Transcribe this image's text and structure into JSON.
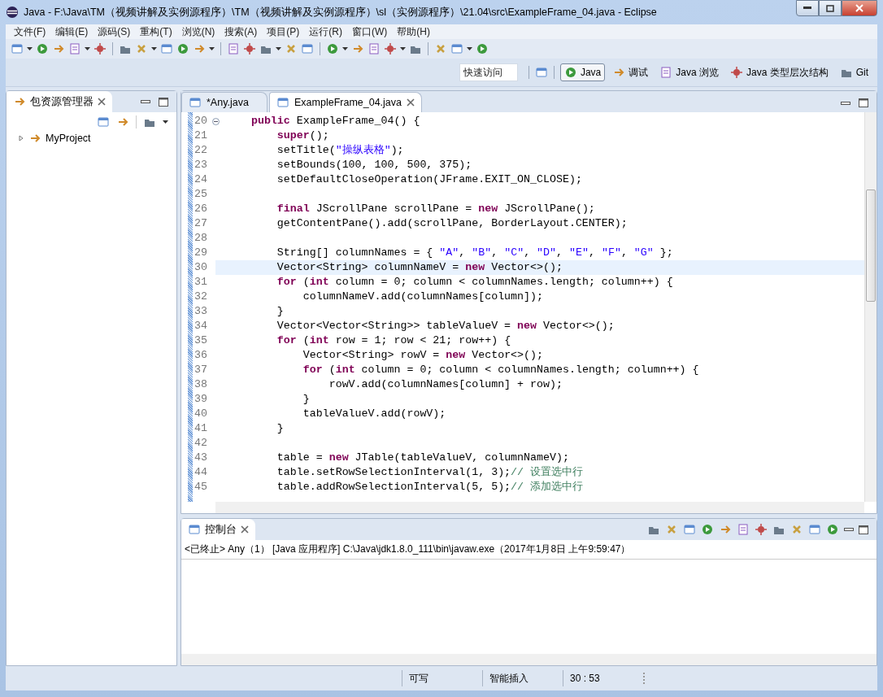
{
  "window": {
    "title": "Java  -  F:\\Java\\TM（视频讲解及实例源程序）\\TM（视频讲解及实例源程序）\\sl（实例源程序）\\21.04\\src\\ExampleFrame_04.java  -  Eclipse"
  },
  "menu": [
    "文件(F)",
    "编辑(E)",
    "源码(S)",
    "重构(T)",
    "浏览(N)",
    "搜索(A)",
    "项目(P)",
    "运行(R)",
    "窗口(W)",
    "帮助(H)"
  ],
  "quick_access": {
    "placeholder": "快速访问"
  },
  "perspectives": [
    {
      "label": "Java",
      "selected": true
    },
    {
      "label": "调试",
      "selected": false
    },
    {
      "label": "Java 浏览",
      "selected": false
    },
    {
      "label": "Java 类型层次结构",
      "selected": false
    },
    {
      "label": "Git",
      "selected": false
    }
  ],
  "explorer": {
    "title": "包资源管理器",
    "items": [
      {
        "label": "MyProject",
        "expanded": false
      }
    ]
  },
  "editor": {
    "tabs": [
      {
        "label": "*Any.java",
        "selected": false
      },
      {
        "label": "ExampleFrame_04.java",
        "selected": true
      }
    ],
    "lines": [
      {
        "number": "20",
        "fold": true,
        "current": false,
        "segments": [
          {
            "kind": "keyword",
            "text": "    public"
          },
          {
            "kind": "plain",
            "text": " ExampleFrame_04() {"
          }
        ]
      },
      {
        "number": "21",
        "fold": false,
        "current": false,
        "segments": [
          {
            "kind": "keyword",
            "text": "        super"
          },
          {
            "kind": "plain",
            "text": "();"
          }
        ]
      },
      {
        "number": "22",
        "fold": false,
        "current": false,
        "segments": [
          {
            "kind": "plain",
            "text": "        setTitle("
          },
          {
            "kind": "string",
            "text": "\"操纵表格\""
          },
          {
            "kind": "plain",
            "text": ");"
          }
        ]
      },
      {
        "number": "23",
        "fold": false,
        "current": false,
        "segments": [
          {
            "kind": "plain",
            "text": "        setBounds(100, 100, 500, 375);"
          }
        ]
      },
      {
        "number": "24",
        "fold": false,
        "current": false,
        "segments": [
          {
            "kind": "plain",
            "text": "        setDefaultCloseOperation(JFrame.EXIT_ON_CLOSE);"
          }
        ]
      },
      {
        "number": "25",
        "fold": false,
        "current": false
      },
      {
        "number": "26",
        "fold": false,
        "current": false,
        "segments": [
          {
            "kind": "keyword",
            "text": "        final"
          },
          {
            "kind": "plain",
            "text": " JScrollPane scrollPane = "
          },
          {
            "kind": "keyword",
            "text": "new"
          },
          {
            "kind": "plain",
            "text": " JScrollPane();"
          }
        ]
      },
      {
        "number": "27",
        "fold": false,
        "current": false,
        "segments": [
          {
            "kind": "plain",
            "text": "        getContentPane().add(scrollPane, BorderLayout.CENTER);"
          }
        ]
      },
      {
        "number": "28",
        "fold": false,
        "current": false
      },
      {
        "number": "29",
        "fold": false,
        "current": false,
        "segments": [
          {
            "kind": "plain",
            "text": "        String[] columnNames = { "
          },
          {
            "kind": "string",
            "text": "\"A\""
          },
          {
            "kind": "plain",
            "text": ", "
          },
          {
            "kind": "string",
            "text": "\"B\""
          },
          {
            "kind": "plain",
            "text": ", "
          },
          {
            "kind": "string",
            "text": "\"C\""
          },
          {
            "kind": "plain",
            "text": ", "
          },
          {
            "kind": "string",
            "text": "\"D\""
          },
          {
            "kind": "plain",
            "text": ", "
          },
          {
            "kind": "string",
            "text": "\"E\""
          },
          {
            "kind": "plain",
            "text": ", "
          },
          {
            "kind": "string",
            "text": "\"F\""
          },
          {
            "kind": "plain",
            "text": ", "
          },
          {
            "kind": "string",
            "text": "\"G\""
          },
          {
            "kind": "plain",
            "text": " };"
          }
        ]
      },
      {
        "number": "30",
        "fold": false,
        "current": true,
        "segments": [
          {
            "kind": "plain",
            "text": "        Vector<String> columnNameV = "
          },
          {
            "kind": "keyword",
            "text": "new"
          },
          {
            "kind": "plain",
            "text": " Vector<>();"
          }
        ]
      },
      {
        "number": "31",
        "fold": false,
        "current": false,
        "segments": [
          {
            "kind": "keyword",
            "text": "        for"
          },
          {
            "kind": "plain",
            "text": " ("
          },
          {
            "kind": "keyword",
            "text": "int"
          },
          {
            "kind": "plain",
            "text": " column = 0; column < columnNames.length; column++) {"
          }
        ]
      },
      {
        "number": "32",
        "fold": false,
        "current": false,
        "segments": [
          {
            "kind": "plain",
            "text": "            columnNameV.add(columnNames[column]);"
          }
        ]
      },
      {
        "number": "33",
        "fold": false,
        "current": false,
        "segments": [
          {
            "kind": "plain",
            "text": "        }"
          }
        ]
      },
      {
        "number": "34",
        "fold": false,
        "current": false,
        "segments": [
          {
            "kind": "plain",
            "text": "        Vector<Vector<String>> tableValueV = "
          },
          {
            "kind": "keyword",
            "text": "new"
          },
          {
            "kind": "plain",
            "text": " Vector<>();"
          }
        ]
      },
      {
        "number": "35",
        "fold": false,
        "current": false,
        "segments": [
          {
            "kind": "keyword",
            "text": "        for"
          },
          {
            "kind": "plain",
            "text": " ("
          },
          {
            "kind": "keyword",
            "text": "int"
          },
          {
            "kind": "plain",
            "text": " row = 1; row < 21; row++) {"
          }
        ]
      },
      {
        "number": "36",
        "fold": false,
        "current": false,
        "segments": [
          {
            "kind": "plain",
            "text": "            Vector<String> rowV = "
          },
          {
            "kind": "keyword",
            "text": "new"
          },
          {
            "kind": "plain",
            "text": " Vector<>();"
          }
        ]
      },
      {
        "number": "37",
        "fold": false,
        "current": false,
        "segments": [
          {
            "kind": "keyword",
            "text": "            for"
          },
          {
            "kind": "plain",
            "text": " ("
          },
          {
            "kind": "keyword",
            "text": "int"
          },
          {
            "kind": "plain",
            "text": " column = 0; column < columnNames.length; column++) {"
          }
        ]
      },
      {
        "number": "38",
        "fold": false,
        "current": false,
        "segments": [
          {
            "kind": "plain",
            "text": "                rowV.add(columnNames[column] + row);"
          }
        ]
      },
      {
        "number": "39",
        "fold": false,
        "current": false,
        "segments": [
          {
            "kind": "plain",
            "text": "            }"
          }
        ]
      },
      {
        "number": "40",
        "fold": false,
        "current": false,
        "segments": [
          {
            "kind": "plain",
            "text": "            tableValueV.add(rowV);"
          }
        ]
      },
      {
        "number": "41",
        "fold": false,
        "current": false,
        "segments": [
          {
            "kind": "plain",
            "text": "        }"
          }
        ]
      },
      {
        "number": "42",
        "fold": false,
        "current": false
      },
      {
        "number": "43",
        "fold": false,
        "current": false,
        "segments": [
          {
            "kind": "plain",
            "text": "        table = "
          },
          {
            "kind": "keyword",
            "text": "new"
          },
          {
            "kind": "plain",
            "text": " JTable(tableValueV, columnNameV);"
          }
        ]
      },
      {
        "number": "44",
        "fold": false,
        "current": false,
        "segments": [
          {
            "kind": "plain",
            "text": "        table.setRowSelectionInterval(1, 3);"
          },
          {
            "kind": "comment",
            "text": "// 设置选中行"
          }
        ]
      },
      {
        "number": "45",
        "fold": false,
        "current": false,
        "segments": [
          {
            "kind": "plain",
            "text": "        table.addRowSelectionInterval(5, 5);"
          },
          {
            "kind": "comment",
            "text": "// 添加选中行"
          }
        ]
      }
    ]
  },
  "console": {
    "title": "控制台",
    "description": "<已终止> Any（1） [Java 应用程序] C:\\Java\\jdk1.8.0_111\\bin\\javaw.exe（2017年1月8日 上午9:59:47）"
  },
  "status_bar": [
    "可写",
    "智能插入",
    "30 : 53"
  ]
}
